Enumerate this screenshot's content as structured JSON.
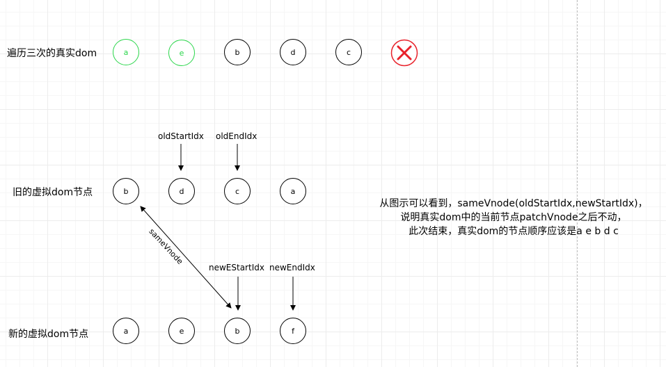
{
  "rows": {
    "real_dom": {
      "label": "遍历三次的真实dom",
      "nodes": [
        {
          "text": "a",
          "highlight": true
        },
        {
          "text": "e",
          "highlight": true
        },
        {
          "text": "b",
          "highlight": false
        },
        {
          "text": "d",
          "highlight": false
        },
        {
          "text": "c",
          "highlight": false
        }
      ],
      "marker": "x-icon"
    },
    "old_vnodes": {
      "label": "旧的虚拟dom节点",
      "nodes": [
        "b",
        "d",
        "c",
        "a"
      ]
    },
    "new_vnodes": {
      "label": "新的虚拟dom节点",
      "nodes": [
        "a",
        "e",
        "b",
        "f"
      ]
    }
  },
  "pointers": {
    "old_start": "oldStartIdx",
    "old_end": "oldEndIdx",
    "new_start": "newEStartIdx",
    "new_end": "newEndIdx"
  },
  "link": {
    "label": "sameVnode",
    "from": "new_vnodes.b",
    "to": "old_vnodes.b"
  },
  "note": {
    "lines": [
      "从图示可以看到，sameVnode(oldStartIdx,newStartIdx)，",
      "说明真实dom中的当前节点patchVnode之后不动，",
      "此次结束，真实dom的节点顺序应该是a e b d c"
    ]
  },
  "colors": {
    "highlight": "#2bd64b",
    "error": "#e8212a",
    "stroke": "#000000"
  }
}
